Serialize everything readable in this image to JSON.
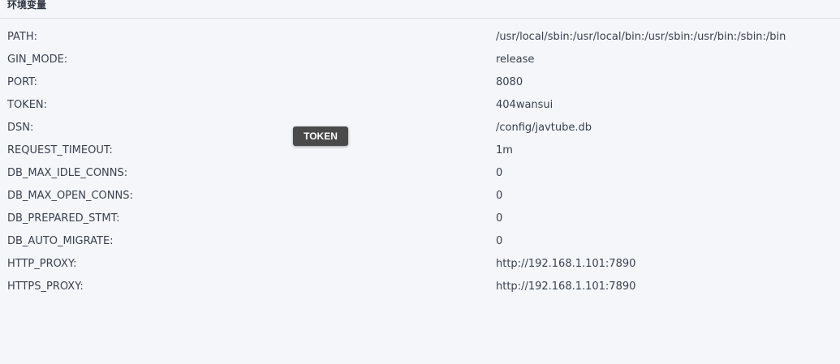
{
  "section": {
    "title": "环境变量"
  },
  "env": [
    {
      "key": "PATH:",
      "value": "/usr/local/sbin:/usr/local/bin:/usr/sbin:/usr/bin:/sbin:/bin"
    },
    {
      "key": "GIN_MODE:",
      "value": "release"
    },
    {
      "key": "PORT:",
      "value": "8080"
    },
    {
      "key": "TOKEN:",
      "value": "404wansui"
    },
    {
      "key": "DSN:",
      "value": "/config/javtube.db"
    },
    {
      "key": "REQUEST_TIMEOUT:",
      "value": "1m"
    },
    {
      "key": "DB_MAX_IDLE_CONNS:",
      "value": "0"
    },
    {
      "key": "DB_MAX_OPEN_CONNS:",
      "value": "0"
    },
    {
      "key": "DB_PREPARED_STMT:",
      "value": "0"
    },
    {
      "key": "DB_AUTO_MIGRATE:",
      "value": "0"
    },
    {
      "key": "HTTP_PROXY:",
      "value": "http://192.168.1.101:7890"
    },
    {
      "key": "HTTPS_PROXY:",
      "value": "http://192.168.1.101:7890"
    }
  ],
  "tooltip": {
    "text": "TOKEN"
  }
}
